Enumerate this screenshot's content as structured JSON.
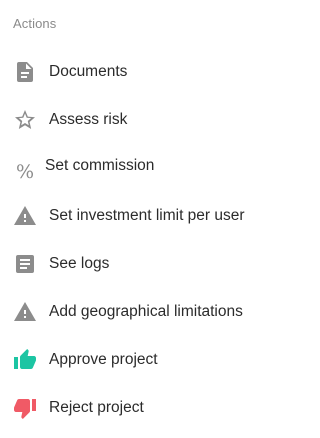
{
  "section_title": "Actions",
  "items": [
    {
      "label": "Documents",
      "icon": "document-icon"
    },
    {
      "label": "Assess risk",
      "icon": "star-outline-icon"
    },
    {
      "label": "Set commission",
      "icon": "percent-icon",
      "glyph": "%"
    },
    {
      "label": "Set investment limit per user",
      "icon": "warning-icon"
    },
    {
      "label": "See logs",
      "icon": "notes-icon"
    },
    {
      "label": "Add geographical limitations",
      "icon": "warning-icon"
    },
    {
      "label": "Approve project",
      "icon": "thumb-up-icon"
    },
    {
      "label": "Reject project",
      "icon": "thumb-down-icon"
    }
  ],
  "colors": {
    "icon_gray": "#8c8c8c",
    "approve": "#1cc5a3",
    "reject": "#f05a66"
  }
}
